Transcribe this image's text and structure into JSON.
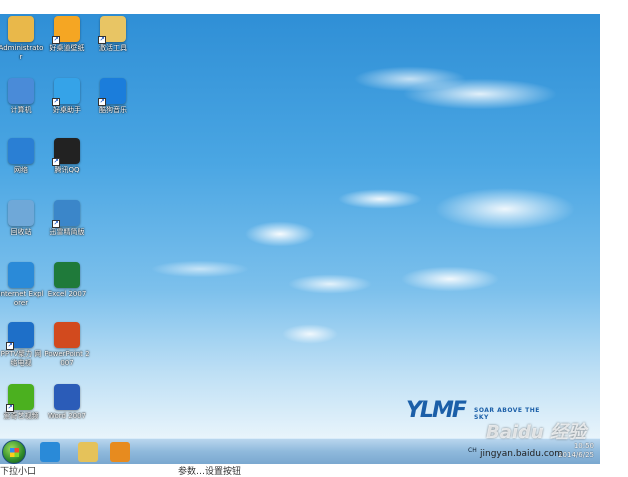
{
  "desktop": {
    "icons": [
      {
        "label": "Administrator",
        "color": "#e9b84a",
        "glyph": "folder-user-icon"
      },
      {
        "label": "好桌道壁纸",
        "color": "#f5a623",
        "glyph": "wallpaper-icon"
      },
      {
        "label": "激活工具",
        "color": "#e8c564",
        "glyph": "folder-icon"
      },
      {
        "label": "计算机",
        "color": "#4a8bd8",
        "glyph": "computer-icon"
      },
      {
        "label": "好桌助手",
        "color": "#35a3e8",
        "glyph": "assistant-icon"
      },
      {
        "label": "酷狗音乐",
        "color": "#1b7ddb",
        "glyph": "kugou-icon"
      },
      {
        "label": "网络",
        "color": "#2a7fd4",
        "glyph": "network-icon"
      },
      {
        "label": "腾讯QQ",
        "color": "#222222",
        "glyph": "qq-icon"
      },
      {
        "label": "回收站",
        "color": "#6fa8d8",
        "glyph": "recycle-bin-icon"
      },
      {
        "label": "迅雷精简版",
        "color": "#3b86c9",
        "glyph": "thunder-icon"
      },
      {
        "label": "Internet Explorer",
        "color": "#2a8ad8",
        "glyph": "ie-icon"
      },
      {
        "label": "Excel 2007",
        "color": "#1f7a3a",
        "glyph": "excel-icon"
      },
      {
        "label": "PPTV聚力 网络电视",
        "color": "#1e6fc8",
        "glyph": "pptv-icon"
      },
      {
        "label": "PowerPoint 2007",
        "color": "#d24a1e",
        "glyph": "powerpoint-icon"
      },
      {
        "label": "爱奇艺视频",
        "color": "#4bb01f",
        "glyph": "iqiyi-icon"
      },
      {
        "label": "Word 2007",
        "color": "#2b5cb8",
        "glyph": "word-icon"
      }
    ],
    "logo": {
      "mark": "YLMF",
      "tagline": "SOAR ABOVE THE SKY"
    }
  },
  "taskbar": {
    "pinned": [
      {
        "name": "ie-icon",
        "color": "#2a8ad8"
      },
      {
        "name": "explorer-icon",
        "color": "#e5c25a"
      },
      {
        "name": "media-player-icon",
        "color": "#e78b1f"
      }
    ],
    "tray_text": "CH",
    "clock_time": "10:50",
    "clock_date": "2014/6/25"
  },
  "overlay": {
    "watermark": "Baidu 经验",
    "watermark_url": "jingyan.baidu.com",
    "caption_left": "下拉小口",
    "caption_mid": "参数…设置按钮"
  }
}
